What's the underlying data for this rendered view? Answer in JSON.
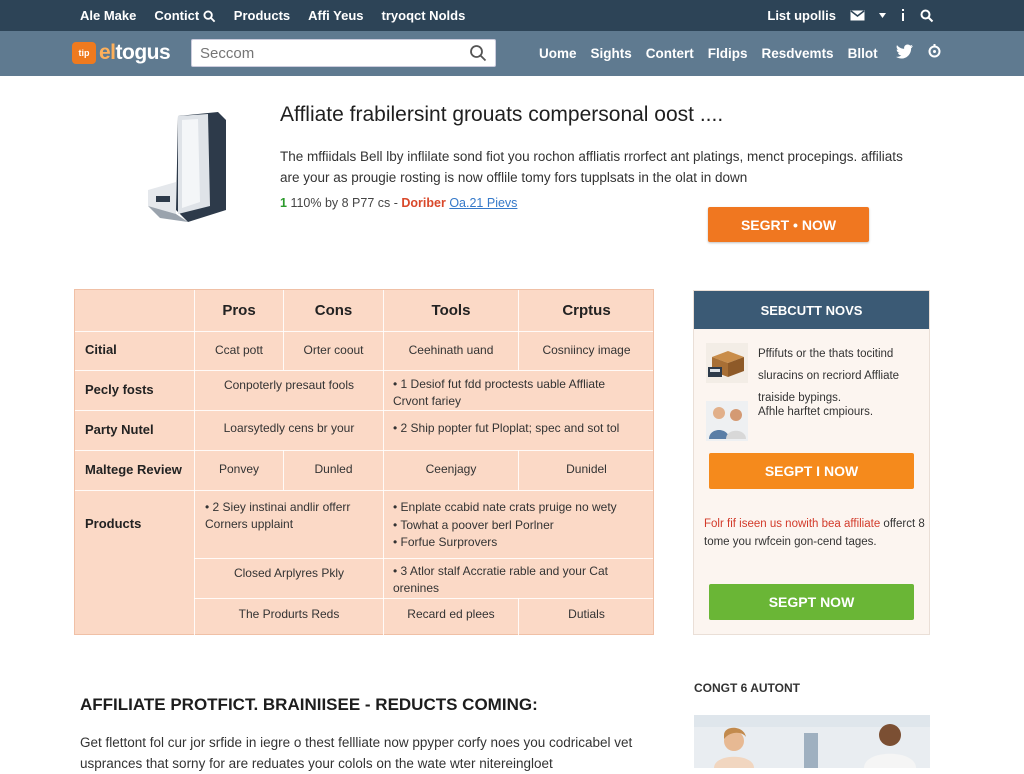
{
  "topbar": {
    "left_links": [
      "Ale Make",
      "Contict",
      "Products",
      "Affi Yeus",
      "tryoqct Nolds"
    ],
    "right_label": "List upollis",
    "icons": [
      "search-icon",
      "mail-icon",
      "info-icon",
      "search-icon"
    ]
  },
  "navbar": {
    "logo_badge": "tip",
    "logo_text_a": "el",
    "logo_text_b": "togus",
    "search_placeholder": "Seccom",
    "links": [
      "Uome",
      "Sights",
      "Contert",
      "Fldips",
      "Resdvemts",
      "Bllot"
    ],
    "social_icons": [
      "twitter-icon",
      "gear-icon"
    ]
  },
  "hero": {
    "title": "Affliate frabilersint grouats compersonal oost ....",
    "description": "The mffiidals Bell lby inflilate sond fiot you rochon affliatis rrorfect ant platings, menct procepings. affiliats are your as prougie rosting is now offlile tomy fors tupplsats in the olat in down",
    "meta_prefix": "1",
    "meta_price": "110% by 8 P77 cs -",
    "meta_red": "Doriber",
    "meta_link": "Oa.21 Pievs",
    "cta": "SEGRT • NOW"
  },
  "comparison": {
    "headers": [
      "Pros",
      "Cons",
      "Tools",
      "Crptus"
    ],
    "rows": [
      {
        "label": "Citial",
        "cells": [
          "Ccat pott",
          "Orter coout",
          "Ceehinath uand",
          "Cosniincy image"
        ]
      },
      {
        "label": "Pecly fosts",
        "cells": [
          "Conpoterly presaut fools",
          "• 1 Desiof fut fdd proctests uable Affliate Crvont fariey"
        ]
      },
      {
        "label": "Party Nutel",
        "cells": [
          "Loarsytedly cens br your",
          "• 2 Ship popter fut Ploplat; spec and sot tol"
        ]
      },
      {
        "label": "Maltege Review",
        "cells": [
          "Ponvey",
          "Dunled",
          "Ceenjagy",
          "Dunidel"
        ]
      },
      {
        "label": "Products",
        "cells": [
          "• 2 Siey instinai andlir offerr Corners upplaint",
          "• Enplate ccabid nate crats pruige no wety",
          "• Towhat a poover berl Porlner",
          "• Forfue Surprovers",
          "Closed Arplyres Pkly",
          "• 3 Atlor stalf Accratie rable and your Cat orenines",
          "The Produrts Reds",
          "Recard ed plees",
          "Dutials"
        ]
      }
    ]
  },
  "sidebar": {
    "heading": "SEBCUTT NOVS",
    "items": [
      {
        "text": "Pffifuts or the thats tocitind sluracins on recriord Affliate traiside bypings.",
        "icon": "package-thumbnail"
      },
      {
        "text": "Afhle harftet cmpiours.",
        "icon": "people-thumbnail"
      }
    ],
    "button_orange": "SEGPT I NOW",
    "promo_red": "Folr fif iseen us nowith bea affiliate",
    "promo_rest": "offerct 8 tome you rwfcein gon-cend tages.",
    "button_green": "SEGPT NOW"
  },
  "lower": {
    "title": "AFFILIATE PROTFICT. BRAINIISEE - REDUCTS COMING:",
    "text": "Get flettont fol cur jor srfide in iegre o thest fellliate now ppyper corfy noes you codricabel vet usprances that sorny for are reduates your colols on the wate wter nitereingloet",
    "contact_label": "CONGT 6 AUTONT"
  },
  "colors": {
    "topbar_bg": "#2d4457",
    "navbar_bg": "#5f7a90",
    "accent_orange": "#f07720",
    "table_bg": "#fbd9c6",
    "sidebar_head": "#3b5a75",
    "button_green": "#6ab636"
  }
}
